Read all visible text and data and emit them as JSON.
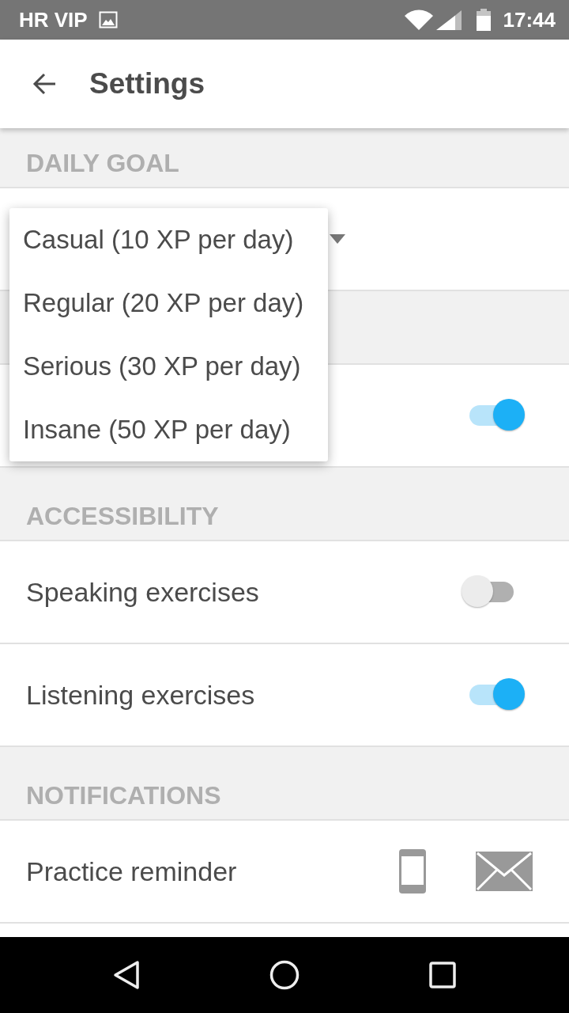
{
  "status_bar": {
    "carrier": "HR VIP",
    "time": "17:44"
  },
  "app_bar": {
    "title": "Settings"
  },
  "sections": [
    {
      "header": "DAILY GOAL",
      "rows": [
        {
          "kind": "dropdown"
        }
      ]
    },
    {
      "rows": [
        {
          "kind": "toggle",
          "on": true
        }
      ]
    },
    {
      "header": "ACCESSIBILITY",
      "rows": [
        {
          "kind": "toggle",
          "label": "Speaking exercises",
          "on": false
        },
        {
          "kind": "toggle",
          "label": "Listening exercises",
          "on": true
        }
      ]
    },
    {
      "header": "NOTIFICATIONS",
      "rows": [
        {
          "kind": "channels",
          "label": "Practice reminder"
        }
      ]
    }
  ],
  "dropdown_menu": {
    "options": [
      {
        "label": "Casual (10 XP per day)"
      },
      {
        "label": "Regular (20 XP per day)"
      },
      {
        "label": "Serious (30 XP per day)"
      },
      {
        "label": "Insane (50 XP per day)"
      }
    ]
  }
}
